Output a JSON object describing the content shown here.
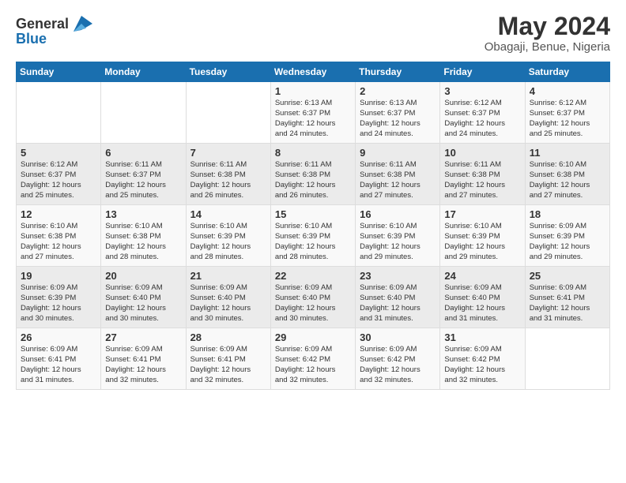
{
  "header": {
    "logo_general": "General",
    "logo_blue": "Blue",
    "month_year": "May 2024",
    "location": "Obagaji, Benue, Nigeria"
  },
  "days_of_week": [
    "Sunday",
    "Monday",
    "Tuesday",
    "Wednesday",
    "Thursday",
    "Friday",
    "Saturday"
  ],
  "weeks": [
    [
      {
        "day": "",
        "info": ""
      },
      {
        "day": "",
        "info": ""
      },
      {
        "day": "",
        "info": ""
      },
      {
        "day": "1",
        "info": "Sunrise: 6:13 AM\nSunset: 6:37 PM\nDaylight: 12 hours\nand 24 minutes."
      },
      {
        "day": "2",
        "info": "Sunrise: 6:13 AM\nSunset: 6:37 PM\nDaylight: 12 hours\nand 24 minutes."
      },
      {
        "day": "3",
        "info": "Sunrise: 6:12 AM\nSunset: 6:37 PM\nDaylight: 12 hours\nand 24 minutes."
      },
      {
        "day": "4",
        "info": "Sunrise: 6:12 AM\nSunset: 6:37 PM\nDaylight: 12 hours\nand 25 minutes."
      }
    ],
    [
      {
        "day": "5",
        "info": "Sunrise: 6:12 AM\nSunset: 6:37 PM\nDaylight: 12 hours\nand 25 minutes."
      },
      {
        "day": "6",
        "info": "Sunrise: 6:11 AM\nSunset: 6:37 PM\nDaylight: 12 hours\nand 25 minutes."
      },
      {
        "day": "7",
        "info": "Sunrise: 6:11 AM\nSunset: 6:38 PM\nDaylight: 12 hours\nand 26 minutes."
      },
      {
        "day": "8",
        "info": "Sunrise: 6:11 AM\nSunset: 6:38 PM\nDaylight: 12 hours\nand 26 minutes."
      },
      {
        "day": "9",
        "info": "Sunrise: 6:11 AM\nSunset: 6:38 PM\nDaylight: 12 hours\nand 27 minutes."
      },
      {
        "day": "10",
        "info": "Sunrise: 6:11 AM\nSunset: 6:38 PM\nDaylight: 12 hours\nand 27 minutes."
      },
      {
        "day": "11",
        "info": "Sunrise: 6:10 AM\nSunset: 6:38 PM\nDaylight: 12 hours\nand 27 minutes."
      }
    ],
    [
      {
        "day": "12",
        "info": "Sunrise: 6:10 AM\nSunset: 6:38 PM\nDaylight: 12 hours\nand 27 minutes."
      },
      {
        "day": "13",
        "info": "Sunrise: 6:10 AM\nSunset: 6:38 PM\nDaylight: 12 hours\nand 28 minutes."
      },
      {
        "day": "14",
        "info": "Sunrise: 6:10 AM\nSunset: 6:39 PM\nDaylight: 12 hours\nand 28 minutes."
      },
      {
        "day": "15",
        "info": "Sunrise: 6:10 AM\nSunset: 6:39 PM\nDaylight: 12 hours\nand 28 minutes."
      },
      {
        "day": "16",
        "info": "Sunrise: 6:10 AM\nSunset: 6:39 PM\nDaylight: 12 hours\nand 29 minutes."
      },
      {
        "day": "17",
        "info": "Sunrise: 6:10 AM\nSunset: 6:39 PM\nDaylight: 12 hours\nand 29 minutes."
      },
      {
        "day": "18",
        "info": "Sunrise: 6:09 AM\nSunset: 6:39 PM\nDaylight: 12 hours\nand 29 minutes."
      }
    ],
    [
      {
        "day": "19",
        "info": "Sunrise: 6:09 AM\nSunset: 6:39 PM\nDaylight: 12 hours\nand 30 minutes."
      },
      {
        "day": "20",
        "info": "Sunrise: 6:09 AM\nSunset: 6:40 PM\nDaylight: 12 hours\nand 30 minutes."
      },
      {
        "day": "21",
        "info": "Sunrise: 6:09 AM\nSunset: 6:40 PM\nDaylight: 12 hours\nand 30 minutes."
      },
      {
        "day": "22",
        "info": "Sunrise: 6:09 AM\nSunset: 6:40 PM\nDaylight: 12 hours\nand 30 minutes."
      },
      {
        "day": "23",
        "info": "Sunrise: 6:09 AM\nSunset: 6:40 PM\nDaylight: 12 hours\nand 31 minutes."
      },
      {
        "day": "24",
        "info": "Sunrise: 6:09 AM\nSunset: 6:40 PM\nDaylight: 12 hours\nand 31 minutes."
      },
      {
        "day": "25",
        "info": "Sunrise: 6:09 AM\nSunset: 6:41 PM\nDaylight: 12 hours\nand 31 minutes."
      }
    ],
    [
      {
        "day": "26",
        "info": "Sunrise: 6:09 AM\nSunset: 6:41 PM\nDaylight: 12 hours\nand 31 minutes."
      },
      {
        "day": "27",
        "info": "Sunrise: 6:09 AM\nSunset: 6:41 PM\nDaylight: 12 hours\nand 32 minutes."
      },
      {
        "day": "28",
        "info": "Sunrise: 6:09 AM\nSunset: 6:41 PM\nDaylight: 12 hours\nand 32 minutes."
      },
      {
        "day": "29",
        "info": "Sunrise: 6:09 AM\nSunset: 6:42 PM\nDaylight: 12 hours\nand 32 minutes."
      },
      {
        "day": "30",
        "info": "Sunrise: 6:09 AM\nSunset: 6:42 PM\nDaylight: 12 hours\nand 32 minutes."
      },
      {
        "day": "31",
        "info": "Sunrise: 6:09 AM\nSunset: 6:42 PM\nDaylight: 12 hours\nand 32 minutes."
      },
      {
        "day": "",
        "info": ""
      }
    ]
  ]
}
